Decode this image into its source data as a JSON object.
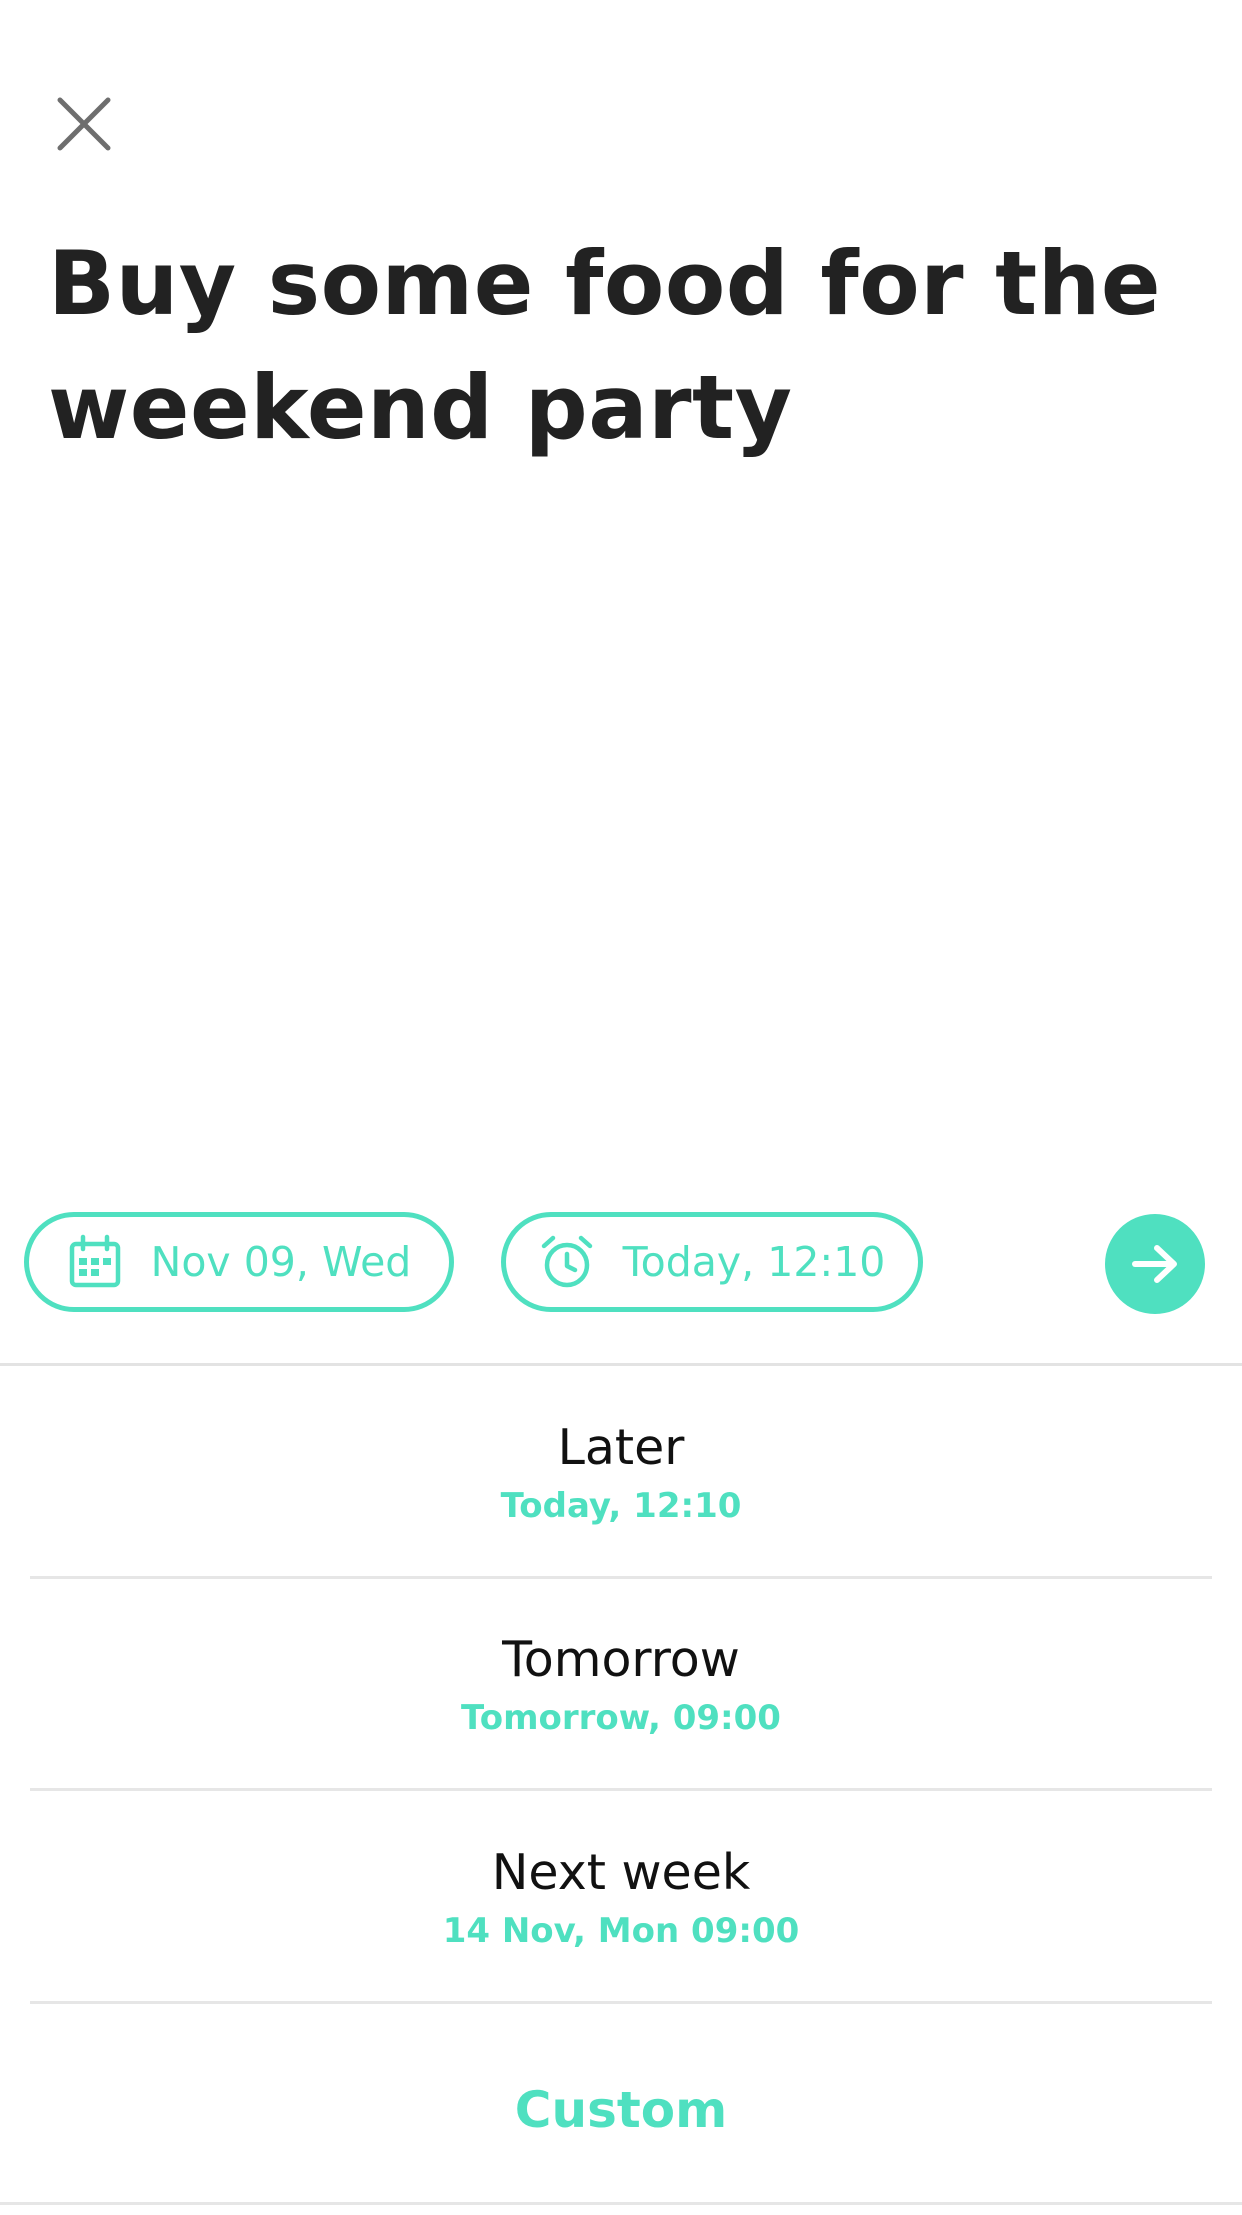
{
  "colors": {
    "accent": "#4fe0c0",
    "title_text": "#222222",
    "close_icon": "#6e6e6e",
    "divider": "#e3e3e3"
  },
  "header": {
    "close_icon": "close-icon"
  },
  "task": {
    "title": "Buy some food for the weekend party"
  },
  "chips": {
    "date": {
      "icon": "calendar-icon",
      "label": "Nov 09, Wed"
    },
    "time": {
      "icon": "alarm-clock-icon",
      "label": "Today, 12:10"
    },
    "send_icon": "arrow-right-icon"
  },
  "options": [
    {
      "label": "Later",
      "sublabel": "Today, 12:10"
    },
    {
      "label": "Tomorrow",
      "sublabel": "Tomorrow, 09:00"
    },
    {
      "label": "Next week",
      "sublabel": "14 Nov, Mon 09:00"
    },
    {
      "label": "Custom"
    }
  ]
}
